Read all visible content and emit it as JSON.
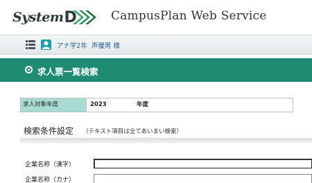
{
  "header": {
    "logo_text": "System",
    "logo_letter": "D",
    "service_title": "CampusPlan Web Service"
  },
  "userbar": {
    "user_class": "アナ学2年",
    "user_name": "声優男 様"
  },
  "section": {
    "title": "求人票一覧検索"
  },
  "year_filter": {
    "label": "求人対象年度",
    "value": "2023",
    "unit": "年度"
  },
  "search_conditions": {
    "title": "検索条件設定",
    "note": "（テキスト項目は全てあいまい検索）",
    "fields": [
      {
        "label": "企業名称（漢字）",
        "value": ""
      },
      {
        "label": "企業名称（カナ）",
        "value": ""
      }
    ]
  },
  "colors": {
    "section_bar": "#1f8b73",
    "year_label_bg": "#a8dcd2",
    "user_icon": "#1e9fa8",
    "user_text": "#2a5d9a"
  },
  "icons": {
    "menu": "grid-list-icon",
    "user": "user-icon",
    "section_bullet": "radio-bullet-icon"
  }
}
